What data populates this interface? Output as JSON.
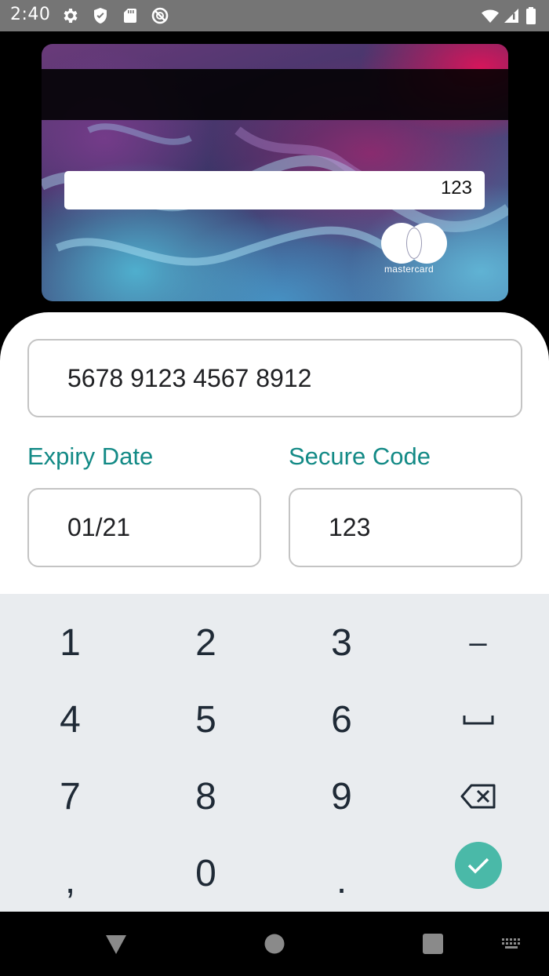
{
  "status_bar": {
    "time": "2:40",
    "left_icons": [
      "gear-icon",
      "shield-icon",
      "sd-card-icon",
      "no-sign-icon"
    ],
    "right_icons": [
      "wifi-icon",
      "signal-icon",
      "battery-icon"
    ]
  },
  "card": {
    "signature_cvv": "123",
    "brand": "mastercard"
  },
  "form": {
    "card_number": "5678 9123 4567 8912",
    "expiry_label": "Expiry Date",
    "expiry_value": "01/21",
    "secure_label": "Secure Code",
    "secure_value": "123"
  },
  "keyboard": {
    "rows": [
      [
        "1",
        "2",
        "3",
        "–"
      ],
      [
        "4",
        "5",
        "6",
        "space"
      ],
      [
        "7",
        "8",
        "9",
        "backspace"
      ],
      [
        ",",
        "0",
        ".",
        "done"
      ]
    ],
    "accent_color": "#4ab9a8"
  },
  "colors": {
    "label": "#138a86",
    "field_border": "#c4c4c4",
    "keyboard_bg": "#e9ecef"
  },
  "nav_bar": {
    "buttons": [
      "back-icon",
      "home-icon",
      "recents-icon",
      "keyboard-switch-icon"
    ]
  }
}
